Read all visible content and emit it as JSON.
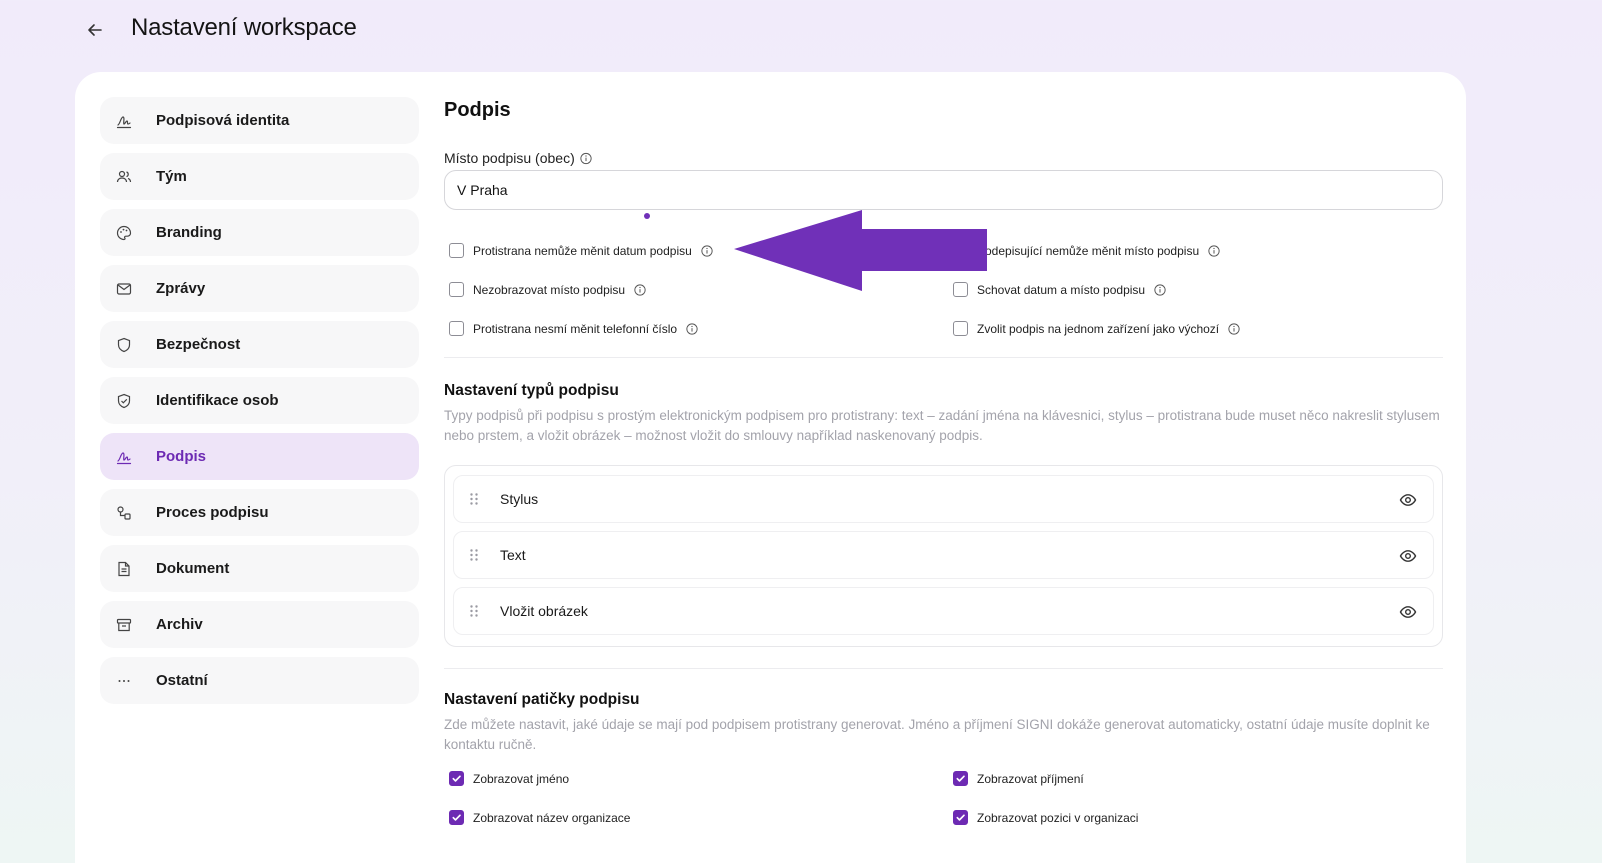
{
  "header": {
    "title": "Nastavení workspace"
  },
  "sidebar": {
    "items": [
      {
        "label": "Podpisová identita"
      },
      {
        "label": "Tým"
      },
      {
        "label": "Branding"
      },
      {
        "label": "Zprávy"
      },
      {
        "label": "Bezpečnost"
      },
      {
        "label": "Identifikace osob"
      },
      {
        "label": "Podpis",
        "active": true
      },
      {
        "label": "Proces podpisu"
      },
      {
        "label": "Dokument"
      },
      {
        "label": "Archiv"
      },
      {
        "label": "Ostatní"
      }
    ]
  },
  "main": {
    "title": "Podpis",
    "place_label": "Místo podpisu (obec)",
    "place_value": "V Praha",
    "options": [
      {
        "label": "Protistrana nemůže měnit datum podpisu",
        "checked": false
      },
      {
        "label": "Podepisující nemůže měnit místo podpisu",
        "checked": false
      },
      {
        "label": "Nezobrazovat místo podpisu",
        "checked": false
      },
      {
        "label": "Schovat datum a místo podpisu",
        "checked": false
      },
      {
        "label": "Protistrana nesmí měnit telefonní číslo",
        "checked": false
      },
      {
        "label": "Zvolit podpis na jednom zařízení jako výchozí",
        "checked": false
      }
    ],
    "types_title": "Nastavení typů podpisu",
    "types_desc": "Typy podpisů při podpisu s prostým elektronickým podpisem pro protistrany: text – zadání jména na klávesnici, stylus – protistrana bude muset něco nakreslit stylusem nebo prstem, a vložit obrázek – možnost vložit do smlouvy například naskenovaný podpis.",
    "types": [
      {
        "label": "Stylus"
      },
      {
        "label": "Text"
      },
      {
        "label": "Vložit obrázek"
      }
    ],
    "footer_title": "Nastavení patičky podpisu",
    "footer_desc": "Zde můžete nastavit, jaké údaje se mají pod podpisem protistrany generovat. Jméno a příjmení SIGNI dokáže generovat automaticky, ostatní údaje musíte doplnit ke kontaktu ručně.",
    "footer_options": [
      {
        "label": "Zobrazovat jméno",
        "checked": true
      },
      {
        "label": "Zobrazovat příjmení",
        "checked": true
      },
      {
        "label": "Zobrazovat název organizace",
        "checked": true
      },
      {
        "label": "Zobrazovat pozici v organizaci",
        "checked": true
      }
    ]
  },
  "colors": {
    "accent": "#6d2ab3",
    "annotation_arrow": "#7030b8"
  },
  "icons": {
    "back": "arrow-left-icon",
    "info": "info-icon",
    "grip": "drag-handle-icon",
    "eye": "eye-icon",
    "check": "check-icon"
  }
}
